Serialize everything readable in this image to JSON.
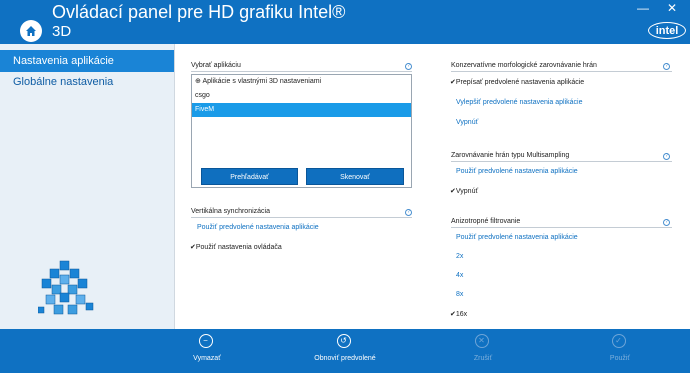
{
  "header": {
    "title": "Ovládací panel pre HD grafiku Intel®",
    "subtitle": "3D",
    "logo_text": "intel"
  },
  "sidebar": {
    "items": [
      {
        "label": "Nastavenia aplikácie",
        "active": true
      },
      {
        "label": "Globálne nastavenia",
        "active": false
      }
    ]
  },
  "app_select": {
    "heading": "Vybrať aplikáciu",
    "list": [
      "Aplikácie s vlastnými 3D nastaveniami",
      "csgo",
      "FiveM"
    ],
    "selected": "FiveM",
    "browse_label": "Prehľadávať",
    "scan_label": "Skenovať"
  },
  "vsync": {
    "heading": "Vertikálna synchronizácia",
    "use_default": "Použiť predvolené nastavenia aplikácie",
    "use_driver": "Použiť nastavenia ovládača"
  },
  "conservative_aa": {
    "heading": "Konzervatívne morfologické zarovnávanie hrán",
    "override": "Prepísať predvolené nastavenia aplikácie",
    "enhance": "Vylepšiť predvolené nastavenia aplikácie",
    "off": "Vypnúť"
  },
  "msaa": {
    "heading": "Zarovnávanie hrán typu Multisampling",
    "use_default": "Použiť predvolené nastavenia aplikácie",
    "off": "Vypnúť"
  },
  "aniso": {
    "heading": "Anizotropné filtrovanie",
    "use_default": "Použiť predvolené nastavenia aplikácie",
    "opt_2x": "2x",
    "opt_4x": "4x",
    "opt_8x": "8x",
    "opt_16x": "16x"
  },
  "bottom": {
    "delete": "Vymazať",
    "restore": "Obnoviť predvolené",
    "cancel": "Zrušiť",
    "apply": "Použiť"
  },
  "colors": {
    "brand_blue": "#0f71c2",
    "selection_blue": "#1a9be8"
  }
}
